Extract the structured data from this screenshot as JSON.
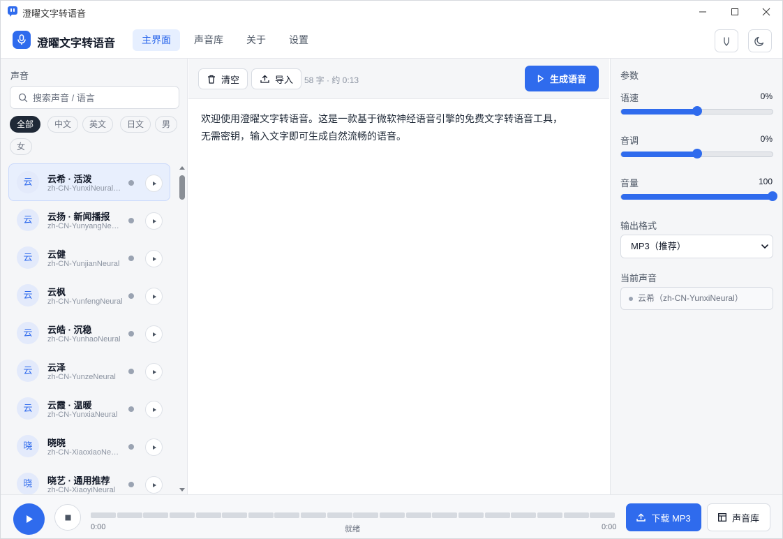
{
  "window": {
    "title": "澄曜文字转语音",
    "minimize_icon": "minimize-icon",
    "maximize_icon": "maximize-icon",
    "close_icon": "close-icon"
  },
  "header": {
    "brand": "澄曜文字转语音",
    "tabs": [
      {
        "label": "主界面",
        "active": true
      },
      {
        "label": "声音库",
        "active": false
      },
      {
        "label": "关于",
        "active": false
      },
      {
        "label": "设置",
        "active": false
      }
    ]
  },
  "sidebar": {
    "title": "声音",
    "search_placeholder": "搜索声音 / 语言",
    "filters": [
      {
        "label": "全部",
        "active": true
      },
      {
        "label": "中文",
        "active": false
      },
      {
        "label": "英文",
        "active": false
      },
      {
        "label": "日文",
        "active": false
      },
      {
        "label": "男",
        "active": false
      },
      {
        "label": "女",
        "active": false
      }
    ],
    "voices": [
      {
        "avatar": "云",
        "name": "云希 · 活泼",
        "id": "zh-CN-YunxiNeural (Male)",
        "selected": true
      },
      {
        "avatar": "云",
        "name": "云扬 · 新闻播报",
        "id": "zh-CN-YunyangNeural",
        "selected": false
      },
      {
        "avatar": "云",
        "name": "云健",
        "id": "zh-CN-YunjianNeural",
        "selected": false
      },
      {
        "avatar": "云",
        "name": "云枫",
        "id": "zh-CN-YunfengNeural",
        "selected": false
      },
      {
        "avatar": "云",
        "name": "云皓 · 沉稳",
        "id": "zh-CN-YunhaoNeural",
        "selected": false
      },
      {
        "avatar": "云",
        "name": "云泽",
        "id": "zh-CN-YunzeNeural",
        "selected": false
      },
      {
        "avatar": "云",
        "name": "云霞 · 温暖",
        "id": "zh-CN-YunxiaNeural",
        "selected": false
      },
      {
        "avatar": "晓",
        "name": "晓晓",
        "id": "zh-CN-XiaoxiaoNeural",
        "selected": false
      },
      {
        "avatar": "晓",
        "name": "晓艺 · 通用推荐",
        "id": "zh-CN-XiaoyiNeural",
        "selected": false
      }
    ]
  },
  "editor": {
    "clear_label": "清空",
    "import_label": "导入",
    "counter": "58 字 · 约 0:13",
    "generate_label": "生成语音",
    "text": "欢迎使用澄曜文字转语音。这是一款基于微软神经语音引擎的免费文字转语音工具，\n无需密钥，输入文字即可生成自然流畅的语音。"
  },
  "params": {
    "title": "参数",
    "rate": {
      "label": "语速",
      "value_text": "0%",
      "level": 0.5
    },
    "pitch": {
      "label": "音调",
      "value_text": "0%",
      "level": 0.5
    },
    "volume": {
      "label": "音量",
      "value_text": "100",
      "level": 1.0
    },
    "format_label": "输出格式",
    "format_value": "MP3（推荐）",
    "current_label": "当前声音",
    "current_value": "云希（zh-CN-YunxiNeural）"
  },
  "player": {
    "time_start": "0:00",
    "time_end": "0:00",
    "status": "就绪",
    "download_label": "下载 MP3",
    "library_label": "声音库"
  },
  "colors": {
    "accent": "#2f6bed",
    "selected_bg": "#e8effd"
  }
}
